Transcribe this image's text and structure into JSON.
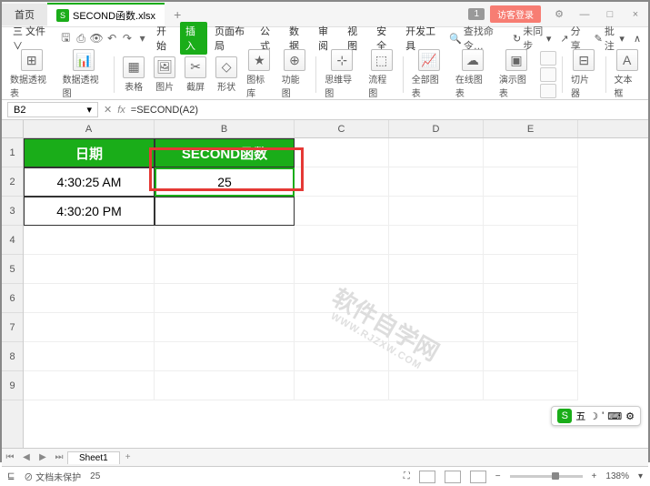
{
  "titlebar": {
    "home": "首页",
    "filename": "SECOND函数.xlsx",
    "badge": "1",
    "login": "访客登录"
  },
  "menubar": {
    "file": "三 文件 ∨",
    "items": [
      "开始",
      "插入",
      "页面布局",
      "公式",
      "数据",
      "审阅",
      "视图",
      "安全",
      "开发工具"
    ],
    "active_index": 1,
    "search": "查找命令…",
    "right": [
      "未同步",
      "分享",
      "批注"
    ]
  },
  "ribbon": {
    "pivotTable": "数据透视表",
    "pivotChart": "数据透视图",
    "table": "表格",
    "picture": "图片",
    "screenshot": "截屏",
    "shapes": "形状",
    "iconLib": "图标库",
    "funcChart": "功能图",
    "mindmap": "思维导图",
    "flowchart": "流程图",
    "allCharts": "全部图表",
    "onlineChart": "在线图表",
    "presentChart": "演示图表",
    "sparkline": "切片器",
    "textbox": "文本框"
  },
  "formula": {
    "cellRef": "B2",
    "formula": "=SECOND(A2)"
  },
  "grid": {
    "cols": [
      "A",
      "B",
      "C",
      "D",
      "E"
    ],
    "rows": [
      "1",
      "2",
      "3",
      "4",
      "5",
      "6",
      "7",
      "8",
      "9"
    ],
    "header_A": "日期",
    "header_B": "SECOND函数",
    "A2": "4:30:25 AM",
    "B2": "25",
    "A3": "4:30:20 PM"
  },
  "watermark": {
    "main": "软件自学网",
    "sub": "WWW.RJZXW.COM"
  },
  "sheet": {
    "name": "Sheet1",
    "add": "+"
  },
  "status": {
    "protect": "文档未保护",
    "value": "25",
    "zoom": "138%"
  },
  "ime": "五"
}
